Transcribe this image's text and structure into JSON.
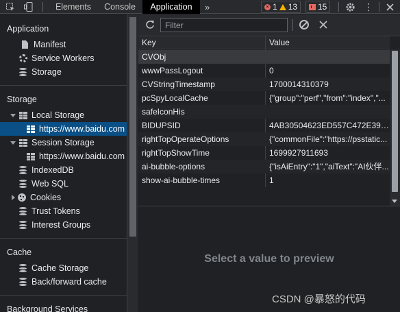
{
  "toolbar": {
    "tabs": [
      "Elements",
      "Console",
      "Application"
    ],
    "more": "»",
    "errors": "1",
    "warnings": "13",
    "issues": "15",
    "more_menu": "⋮"
  },
  "sidebar": {
    "application_title": "Application",
    "application_items": [
      "Manifest",
      "Service Workers",
      "Storage"
    ],
    "storage_title": "Storage",
    "local_storage": "Local Storage",
    "local_storage_origin": "https://www.baidu.com",
    "session_storage": "Session Storage",
    "session_storage_origin": "https://www.baidu.com",
    "indexeddb": "IndexedDB",
    "websql": "Web SQL",
    "cookies": "Cookies",
    "trust_tokens": "Trust Tokens",
    "interest_groups": "Interest Groups",
    "cache_title": "Cache",
    "cache_items": [
      "Cache Storage",
      "Back/forward cache"
    ],
    "background_title": "Background Services"
  },
  "main": {
    "filter_placeholder": "Filter",
    "col_key": "Key",
    "col_value": "Value",
    "rows": [
      {
        "key": "CVObj",
        "value": ""
      },
      {
        "key": "wwwPassLogout",
        "value": "0"
      },
      {
        "key": "CVStringTimestamp",
        "value": "1700014310379"
      },
      {
        "key": "pcSpyLocalCache",
        "value": "{\"group\":\"perf\",\"from\":\"index\",\"..."
      },
      {
        "key": "safeIconHis",
        "value": ""
      },
      {
        "key": "BIDUPSID",
        "value": "4AB30504623ED557C472E3927..."
      },
      {
        "key": "rightTopOperateOptions",
        "value": "{\"commonFile\":\"https://psstatic..."
      },
      {
        "key": "rightTopShowTime",
        "value": "1699927911693"
      },
      {
        "key": "ai-bubble-options",
        "value": "{\"isAiEntry\":\"1\",\"aiText\":\"AI伙伴..."
      },
      {
        "key": "show-ai-bubble-times",
        "value": "1"
      }
    ],
    "preview": "Select a value to preview"
  },
  "watermark": "CSDN @暴怒的代码",
  "colors": {
    "selection": "#0a4f85",
    "background": "#202124",
    "error": "#e46962",
    "warning": "#f2b300"
  }
}
